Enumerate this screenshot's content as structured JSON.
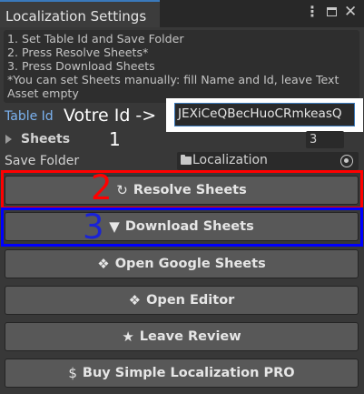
{
  "window": {
    "tab_title": "Localization Settings",
    "controls": {
      "menu": "kebab-menu-icon",
      "maximize": "maximize-icon",
      "close": "close-icon"
    }
  },
  "help": {
    "lines": [
      "1. Set Table Id and Save Folder",
      "2. Press Resolve Sheets*",
      "3. Press Download Sheets",
      "*You can set Sheets manually: fill Name and Id, leave Text",
      "Asset empty"
    ]
  },
  "table_id": {
    "label": "Table Id",
    "value": "JEXiCeQBecHuoCRmkeasQ",
    "annotation": "Votre Id ->"
  },
  "sheets": {
    "label": "Sheets",
    "count": "3",
    "annotation": "1"
  },
  "save_folder": {
    "label": "Save Folder",
    "value": "Localization"
  },
  "buttons": {
    "resolve": {
      "icon": "↻",
      "label": "Resolve Sheets"
    },
    "download": {
      "icon": "▼",
      "label": "Download Sheets"
    },
    "google": {
      "icon": "❖",
      "label": "Open Google Sheets"
    },
    "editor": {
      "icon": "❖",
      "label": "Open Editor"
    },
    "review": {
      "icon": "★",
      "label": "Leave Review"
    },
    "buy": {
      "icon": "$",
      "label": "Buy Simple Localization PRO"
    }
  },
  "annotations": {
    "resolve_step": "2",
    "download_step": "3"
  },
  "colors": {
    "accent": "#3a79bb",
    "label_blue": "#7bb2f0",
    "highlight_red": "#ff0000",
    "highlight_blue": "#0000ff"
  }
}
